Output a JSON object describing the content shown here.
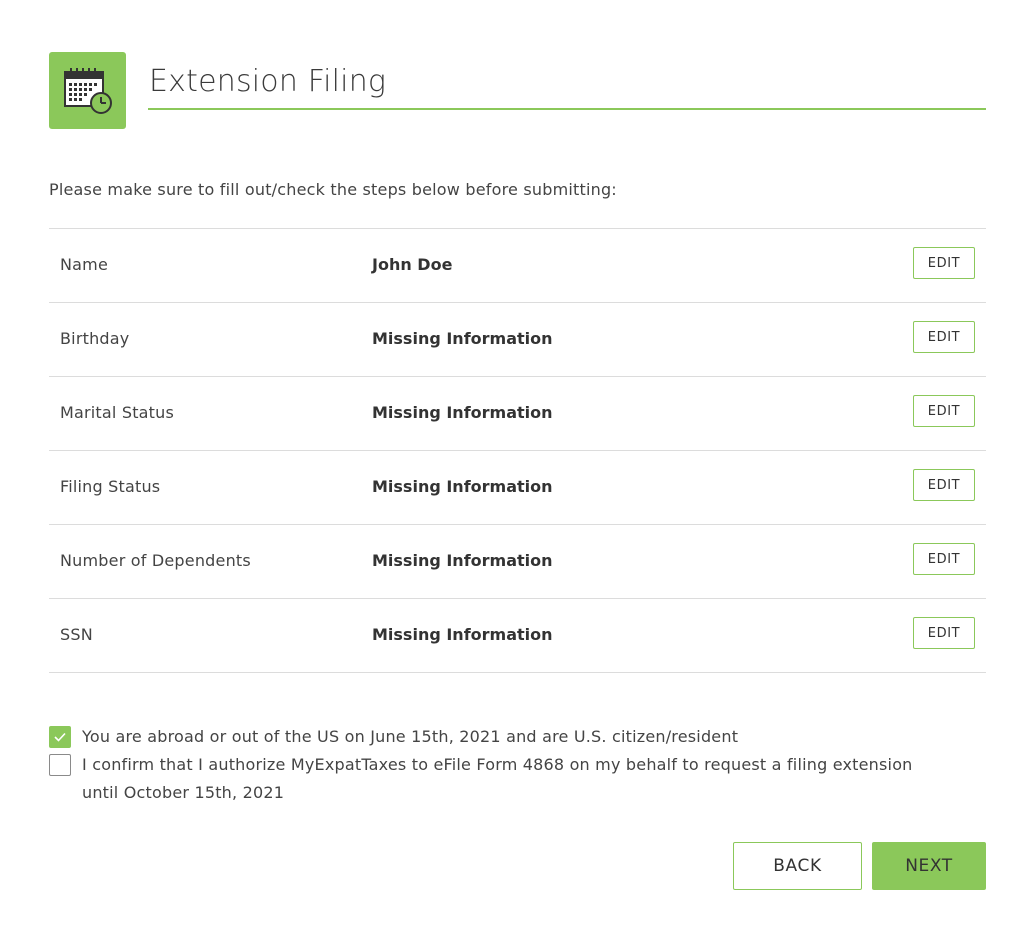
{
  "header": {
    "title": "Extension Filing",
    "icon": "calendar-clock-icon",
    "accent_color": "#8bc85a"
  },
  "intro_text": "Please make sure to fill out/check the steps below before submitting:",
  "steps": [
    {
      "label": "Name",
      "value": "John Doe",
      "action": "EDIT"
    },
    {
      "label": "Birthday",
      "value": "Missing Information",
      "action": "EDIT"
    },
    {
      "label": "Marital Status",
      "value": "Missing Information",
      "action": "EDIT"
    },
    {
      "label": "Filing Status",
      "value": "Missing Information",
      "action": "EDIT"
    },
    {
      "label": "Number of Dependents",
      "value": "Missing Information",
      "action": "EDIT"
    },
    {
      "label": "SSN",
      "value": "Missing Information",
      "action": "EDIT"
    }
  ],
  "consents": [
    {
      "text": "You are abroad or out of the US on June 15th, 2021 and are U.S. citizen/resident",
      "checked": true
    },
    {
      "text": "I confirm that I authorize MyExpatTaxes to eFile Form 4868 on my behalf to request a filing extension until October 15th, 2021",
      "checked": false
    }
  ],
  "buttons": {
    "back": "BACK",
    "next": "NEXT"
  }
}
